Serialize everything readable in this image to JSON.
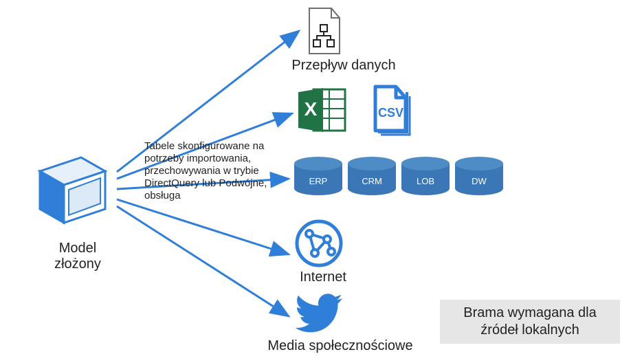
{
  "colors": {
    "arrow": "#2f7ed8",
    "icon_blue": "#2f7ed8",
    "excel_green": "#217346",
    "db_top": "#4e8cc6",
    "db_body": "#3b77b7",
    "note_bg": "#e6e6e6"
  },
  "model": {
    "label": "Model\nzłożony"
  },
  "arrow_annotation": "Tabele skonfigurowane na potrzeby importowania, przechowywania w trybie DirectQuery lub Podwójne, obsługa",
  "targets": {
    "dataflow": {
      "label": "Przepływ danych"
    },
    "excel": {
      "label": ""
    },
    "csv": {
      "label": "CSV"
    },
    "databases": [
      {
        "label": "ERP"
      },
      {
        "label": "CRM"
      },
      {
        "label": "LOB"
      },
      {
        "label": "DW"
      }
    ],
    "internet": {
      "label": "Internet"
    },
    "social_media": {
      "label": "Media społecznościowe"
    }
  },
  "note": "Brama wymagana dla źródeł lokalnych"
}
